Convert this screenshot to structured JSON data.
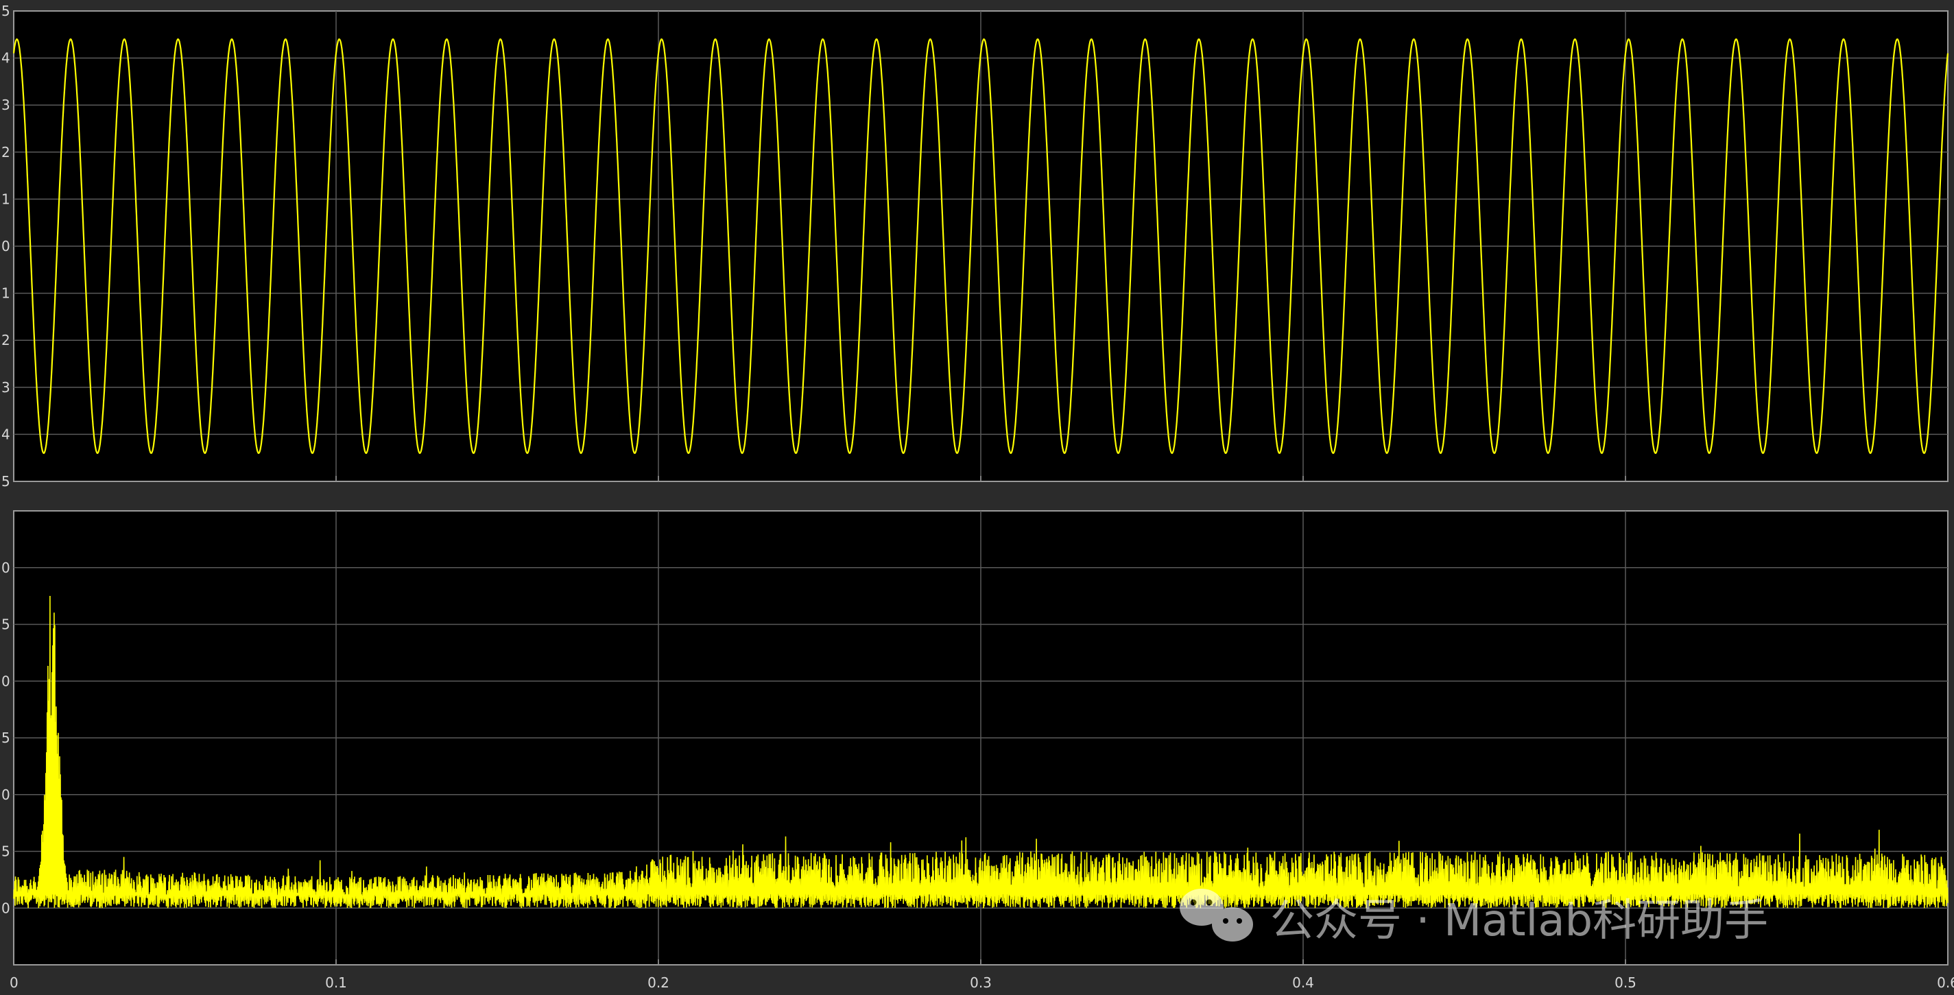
{
  "theme": {
    "background": "#2b2b2b",
    "plot_background": "#000000",
    "grid_color": "#5a5a5a",
    "axes_color": "#9a9a9a",
    "signal_color": "#ffff00",
    "tick_color": "#d8d8d8"
  },
  "watermark": {
    "text": "公众号 · Matlab科研助手",
    "icon": "wechat-icon"
  },
  "chart_data": [
    {
      "type": "line",
      "title": "",
      "xlabel": "",
      "ylabel": "",
      "xlim": [
        0,
        0.6
      ],
      "ylim": [
        -5,
        5
      ],
      "grid": true,
      "x_ticks": [
        0,
        0.1,
        0.2,
        0.3,
        0.4,
        0.5,
        0.6
      ],
      "x_tick_labels": [
        "",
        "",
        "",
        "",
        "",
        "",
        ""
      ],
      "y_ticks": [
        5,
        4,
        3,
        2,
        1,
        0,
        -1,
        -2,
        -3,
        -4,
        -5
      ],
      "y_tick_labels": [
        "5",
        "4",
        "3",
        "2",
        "1",
        "0",
        "1",
        "2",
        "3",
        "4",
        "5"
      ],
      "series": [
        {
          "signal": "sine",
          "amplitude": 4.4,
          "frequency_hz": 60,
          "phase_rad": 1.2,
          "color": "#ffff00"
        }
      ]
    },
    {
      "type": "line",
      "title": "",
      "xlabel": "",
      "ylabel": "",
      "xlim": [
        0,
        0.6
      ],
      "ylim": [
        -0.2,
        1.4
      ],
      "grid": true,
      "x_ticks": [
        0,
        0.1,
        0.2,
        0.3,
        0.4,
        0.5,
        0.6
      ],
      "x_tick_labels": [
        "0",
        "0.1",
        "0.2",
        "0.3",
        "0.4",
        "0.5",
        "0.6"
      ],
      "y_ticks": [
        1.2,
        1.0,
        0.8,
        0.6,
        0.4,
        0.2,
        0.0
      ],
      "y_tick_labels": [
        "0",
        "5",
        "0",
        "5",
        "0",
        "5",
        "0"
      ],
      "series": [
        {
          "signal": "noisy-error",
          "baseline": 0.0,
          "peak_time": 0.012,
          "peak_value": 1.22,
          "noise_envelope": [
            {
              "x": 0.0,
              "y": 0.12
            },
            {
              "x": 0.02,
              "y": 0.14
            },
            {
              "x": 0.1,
              "y": 0.11
            },
            {
              "x": 0.19,
              "y": 0.13
            },
            {
              "x": 0.2,
              "y": 0.19
            },
            {
              "x": 0.3,
              "y": 0.2
            },
            {
              "x": 0.4,
              "y": 0.2
            },
            {
              "x": 0.5,
              "y": 0.2
            },
            {
              "x": 0.6,
              "y": 0.19
            }
          ],
          "color": "#ffff00"
        }
      ]
    }
  ]
}
